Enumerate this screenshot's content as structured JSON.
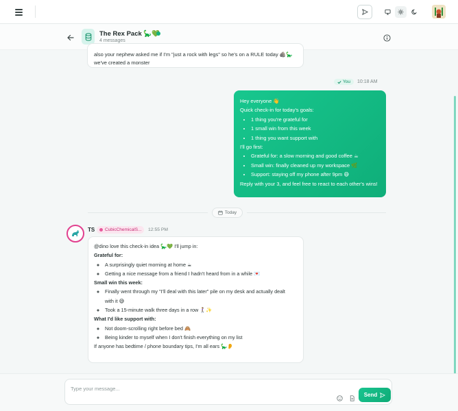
{
  "chat": {
    "title": "The Rex Pack 🦕💚",
    "subtitle": "4 messages"
  },
  "previous_message": {
    "line1": "also your nephew asked me if I'm \"just a rock with legs\" so he's on a RULE today 🪨🦕",
    "line2": "we've created a monster"
  },
  "my_message": {
    "badge": "You",
    "time": "10:18 AM",
    "greeting": "Hey everyone 👋",
    "intro": "Quick check-in for today's goals:",
    "goals": [
      "1 thing you're grateful for",
      "1 small win from this week",
      "1 thing you want support with"
    ],
    "go_first": "I'll go first:",
    "answers": [
      "Grateful for: a slow morning and good coffee ☕",
      "Small win: finally cleaned up my workspace 🌿",
      "Support: staying off my phone after 9pm 😅"
    ],
    "closing": "Reply with your 3, and feel free to react to each other's wins!"
  },
  "date_divider": "Today",
  "ts_message": {
    "sender": "TS",
    "tag": "CubicChemicalS...",
    "time": "12:55 PM",
    "intro": "@dino love this check-in idea 🦕💚 I'll jump in:",
    "h1": "Grateful for:",
    "grateful": [
      "A surprisingly quiet morning at home ☕",
      "Getting a nice message from a friend I hadn't heard from in a while 💌"
    ],
    "h2": "Small win this week:",
    "win1": "Finally went through my \"I'll deal with this later\" pile on my desk and actually dealt",
    "win1b": "with it 😅",
    "win2": "Took a 15-minute walk three days in a row 🚶‍♀️✨",
    "h3": "What I'd like support with:",
    "support": [
      "Not doom-scrolling right before bed 🙈",
      "Being kinder to myself when I don't finish everything on my list"
    ],
    "closing": "If anyone has bedtime / phone boundary tips, I'm all ears 🦕👂"
  },
  "composer": {
    "placeholder": "Type your message...",
    "send_label": "Send"
  }
}
